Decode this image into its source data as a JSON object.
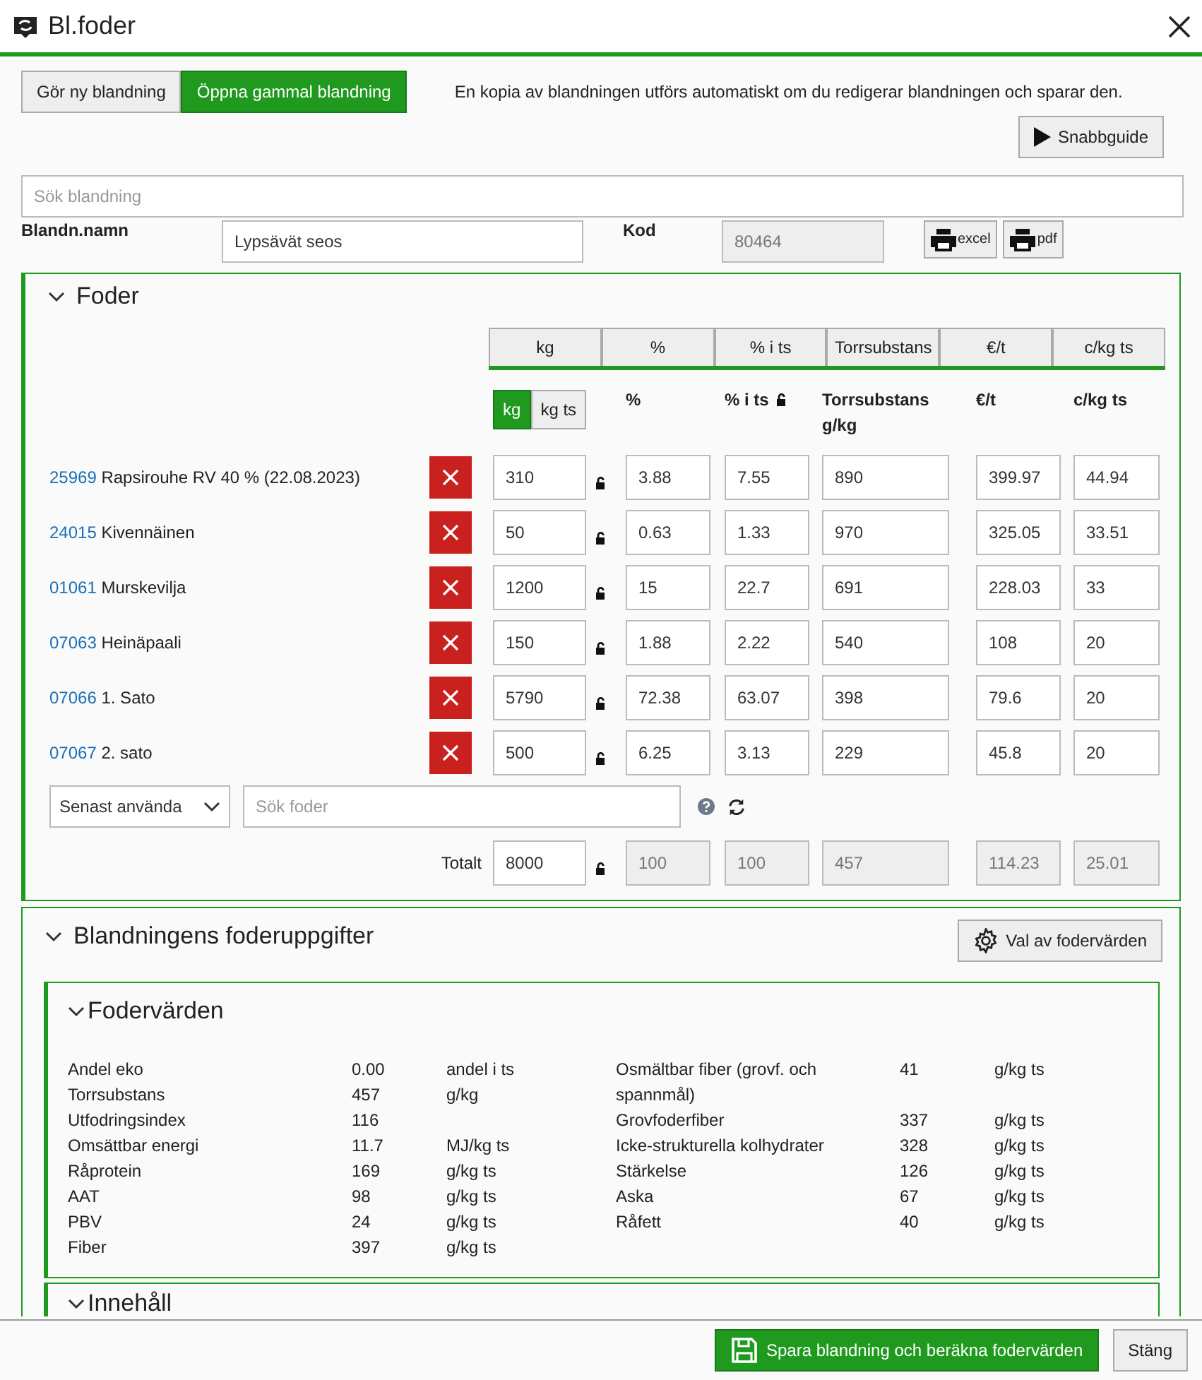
{
  "window": {
    "title": "Bl.foder"
  },
  "modes": [
    {
      "label": "Gör ny blandning",
      "selected": false
    },
    {
      "label": "Öppna gammal blandning",
      "selected": true
    }
  ],
  "notice": "En kopia av blandningen utförs automatiskt om du redigerar blandningen och sparar den.",
  "guide_button": "Snabbguide",
  "search": {
    "placeholder": "Sök blandning"
  },
  "name_label": "Blandn.namn",
  "name_value": "Lypsävät seos",
  "code_label": "Kod",
  "code_value": "80464",
  "export_buttons": [
    "excel",
    "pdf"
  ],
  "foder": {
    "title": "Foder",
    "column_toggles": [
      "kg",
      "%",
      "% i ts",
      "Torrsubstans",
      "€/t",
      "c/kg ts"
    ],
    "units": [
      {
        "label": "kg",
        "selected": true
      },
      {
        "label": "kg ts",
        "selected": false
      }
    ],
    "headers": [
      "%",
      "% i ts",
      "Torrsubstans g/kg",
      "€/t",
      "c/kg ts"
    ],
    "rows": [
      {
        "code": "25969",
        "name": "Rapsirouhe RV 40 % (22.08.2023)",
        "kg": "310",
        "pct": "3.88",
        "pct_ts": "7.55",
        "ts": "890",
        "eur_t": "399.97",
        "c_kg_ts": "44.94"
      },
      {
        "code": "24015",
        "name": "Kivennäinen",
        "kg": "50",
        "pct": "0.63",
        "pct_ts": "1.33",
        "ts": "970",
        "eur_t": "325.05",
        "c_kg_ts": "33.51"
      },
      {
        "code": "01061",
        "name": "Murskevilja",
        "kg": "1200",
        "pct": "15",
        "pct_ts": "22.7",
        "ts": "691",
        "eur_t": "228.03",
        "c_kg_ts": "33"
      },
      {
        "code": "07063",
        "name": "Heinäpaali",
        "kg": "150",
        "pct": "1.88",
        "pct_ts": "2.22",
        "ts": "540",
        "eur_t": "108",
        "c_kg_ts": "20"
      },
      {
        "code": "07066",
        "name": "1. Sato",
        "kg": "5790",
        "pct": "72.38",
        "pct_ts": "63.07",
        "ts": "398",
        "eur_t": "79.6",
        "c_kg_ts": "20"
      },
      {
        "code": "07067",
        "name": "2. sato",
        "kg": "500",
        "pct": "6.25",
        "pct_ts": "3.13",
        "ts": "229",
        "eur_t": "45.8",
        "c_kg_ts": "20"
      }
    ],
    "source_select": "Senast använda",
    "feed_search": {
      "placeholder": "Sök foder"
    },
    "total": {
      "label": "Totalt",
      "kg": "8000",
      "pct": "100",
      "pct_ts": "100",
      "ts": "457",
      "eur_t": "114.23",
      "c_kg_ts": "25.01"
    }
  },
  "uppgifter": {
    "title": "Blandningens foderuppgifter",
    "settings_button": "Val av fodervärden",
    "fodervarden": {
      "title": "Fodervärden",
      "left": [
        {
          "label": "Andel eko",
          "value": "0.00",
          "unit": "andel i ts"
        },
        {
          "label": "Torrsubstans",
          "value": "457",
          "unit": "g/kg"
        },
        {
          "label": "Utfodringsindex",
          "value": "116"
        },
        {
          "label": "Omsättbar energi",
          "value": "11.7",
          "unit": "MJ/kg ts"
        },
        {
          "label": "Råprotein",
          "value": "169",
          "unit": "g/kg ts"
        },
        {
          "label": "AAT",
          "value": "98",
          "unit": "g/kg ts"
        },
        {
          "label": "PBV",
          "value": "24",
          "unit": "g/kg ts"
        },
        {
          "label": "Fiber",
          "value": "397",
          "unit": "g/kg ts"
        }
      ],
      "right": [
        {
          "label": "Osmältbar fiber (grovf. och spannmål)",
          "value": "41",
          "unit": "g/kg ts"
        },
        {
          "label": "Grovfoderfiber",
          "value": "337",
          "unit": "g/kg ts"
        },
        {
          "label": "Icke-strukturella kolhydrater",
          "value": "328",
          "unit": "g/kg ts"
        },
        {
          "label": "Stärkelse",
          "value": "126",
          "unit": "g/kg ts"
        },
        {
          "label": "Aska",
          "value": "67",
          "unit": "g/kg ts"
        },
        {
          "label": "Råfett",
          "value": "40",
          "unit": "g/kg ts"
        }
      ]
    },
    "next_section": "Innehåll"
  },
  "footer": {
    "save_button": "Spara blandning och beräkna fodervärden",
    "close_button": "Stäng"
  }
}
